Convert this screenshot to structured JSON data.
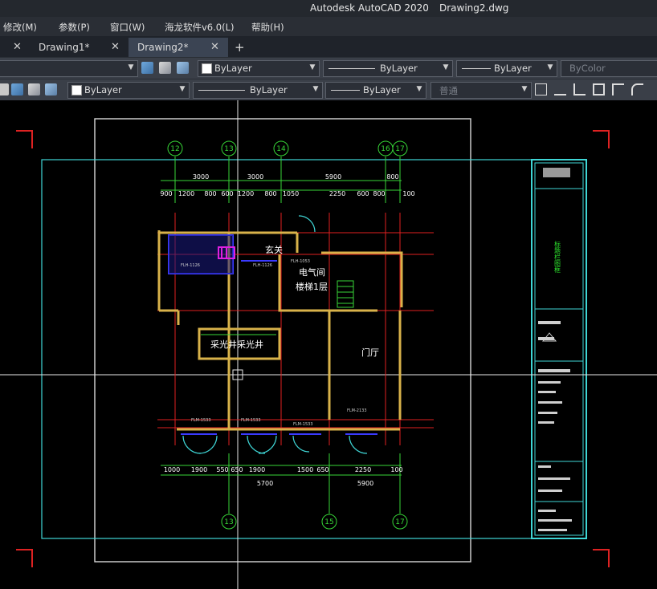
{
  "titlebar": {
    "app_name": "Autodesk AutoCAD 2020",
    "document": "Drawing2.dwg"
  },
  "menu": [
    "修改(M)",
    "参数(P)",
    "窗口(W)",
    "海龙软件v6.0(L)",
    "帮助(H)"
  ],
  "tabs": [
    {
      "label": "Drawing1*",
      "active": false
    },
    {
      "label": "Drawing2*",
      "active": true
    }
  ],
  "tab_close_glyph": "✕",
  "new_tab_glyph": "+",
  "ribbon1": {
    "color": "ByLayer",
    "linetype": "ByLayer",
    "lineweight": "ByLayer",
    "plotstyle": "ByColor"
  },
  "ribbon2": {
    "color": "ByLayer",
    "linetype": "ByLayer",
    "lineweight": "ByLayer",
    "style": "普通"
  },
  "drawing": {
    "axes_top": [
      "12",
      "13",
      "14",
      "16",
      "17"
    ],
    "axes_bottom": [
      "13",
      "15",
      "17"
    ],
    "top_dims_row1": [
      "3000",
      "3000",
      "5900",
      "800"
    ],
    "top_dims_row2": [
      "900",
      "1200",
      "800",
      "600",
      "1200",
      "800",
      "1050",
      "2250",
      "600",
      "800",
      "100"
    ],
    "bottom_dims_row1": [
      "1000",
      "1900",
      "550",
      "650",
      "1900",
      "1500",
      "650",
      "2250",
      "100"
    ],
    "bottom_dims_row2": [
      "5700",
      "5900"
    ],
    "room_labels": [
      "玄关",
      "电气间",
      "楼梯1层",
      "采光井采光井",
      "门厅"
    ],
    "door_tags": [
      "FLH-1126",
      "FLH-1126",
      "FLH-1053",
      "FLM-1533",
      "FLM-1533",
      "FLM-1533",
      "FLM-2133"
    ],
    "sheet_title_vertical": "标题栏图框"
  },
  "colors": {
    "titlebar": "#24282e",
    "menubar": "#2a2e35",
    "ribbon": "#3a3f48",
    "canvas": "#000000",
    "wall": "#d8b24a",
    "axis": "#37d637",
    "grid_red": "#e02020",
    "frame_cyan": "#3fd6d6",
    "magenta": "#e020e0"
  }
}
